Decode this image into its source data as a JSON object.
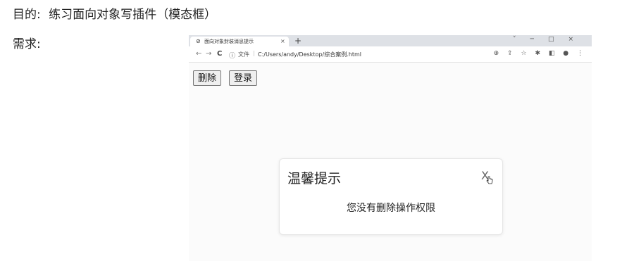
{
  "doc": {
    "purpose_label": "目的:",
    "purpose_text": "练习面向对象写插件（模态框）",
    "requirement_label": "需求:"
  },
  "browser": {
    "tab_title": "面向对象封装消息提示",
    "tab_close": "×",
    "new_tab": "+",
    "url_scheme_label": "文件",
    "url": "C:/Users/andy/Desktop/综合案例.html",
    "icons": [
      "back-icon",
      "forward-icon",
      "reload-icon",
      "info-icon",
      "zoom-icon",
      "share-icon",
      "star-icon",
      "extensions-icon",
      "sidepanel-icon",
      "profile-icon",
      "menu-icon"
    ]
  },
  "page": {
    "delete_label": "删除",
    "login_label": "登录"
  },
  "modal": {
    "title": "温馨提示",
    "close": "X",
    "message": "您没有删除操作权限"
  }
}
